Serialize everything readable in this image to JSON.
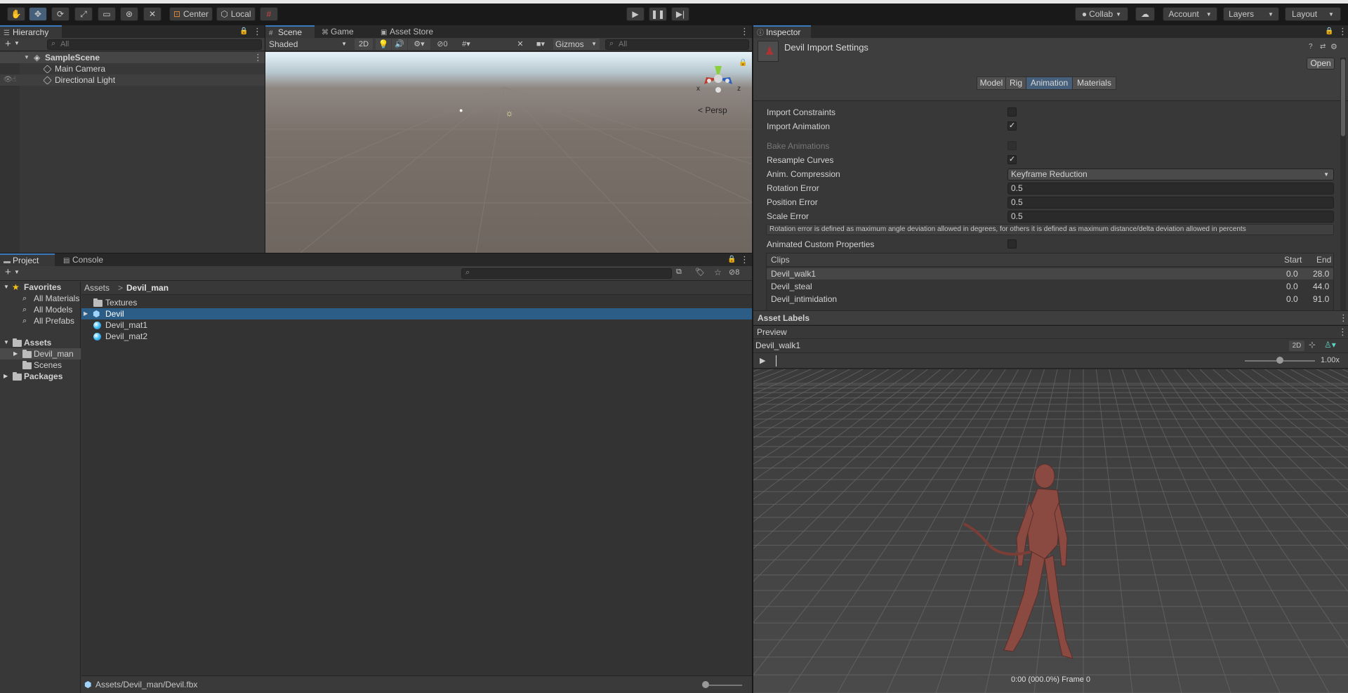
{
  "toolbar": {
    "tools": [
      "hand-tool",
      "move-tool",
      "rotate-tool",
      "scale-tool",
      "rect-tool",
      "transform-tool",
      "custom-tool"
    ],
    "pivot": "Center",
    "space": "Local",
    "collab": "Collab",
    "account": "Account",
    "layers": "Layers",
    "layout": "Layout"
  },
  "hierarchy": {
    "tab": "Hierarchy",
    "search_placeholder": "All",
    "scene": "SampleScene",
    "items": [
      "Main Camera",
      "Directional Light"
    ]
  },
  "scene_view": {
    "tabs": [
      "Scene",
      "Game",
      "Asset Store"
    ],
    "shading": "Shaded",
    "mode_2d": "2D",
    "hidden_count": "0",
    "gizmos": "Gizmos",
    "search_placeholder": "All",
    "persp": "< Persp",
    "axis_x": "x",
    "axis_z": "z"
  },
  "project": {
    "tabs": [
      "Project",
      "Console"
    ],
    "favorites_label": "Favorites",
    "favorites": [
      "All Materials",
      "All Models",
      "All Prefabs"
    ],
    "assets_label": "Assets",
    "asset_folders": [
      "Devil_man",
      "Scenes"
    ],
    "packages_label": "Packages",
    "breadcrumb_root": "Assets",
    "breadcrumb_sep": ">",
    "breadcrumb_current": "Devil_man",
    "files": [
      "Textures",
      "Devil",
      "Devil_mat1",
      "Devil_mat2"
    ],
    "hidden_count": "8",
    "status_path": "Assets/Devil_man/Devil.fbx"
  },
  "inspector": {
    "tab": "Inspector",
    "title": "Devil Import Settings",
    "open_button": "Open",
    "tabs": [
      "Model",
      "Rig",
      "Animation",
      "Materials"
    ],
    "selected_tab": "Animation",
    "import_constraints_label": "Import Constraints",
    "import_constraints": false,
    "import_animation_label": "Import Animation",
    "import_animation": true,
    "bake_animations_label": "Bake Animations",
    "resample_curves_label": "Resample Curves",
    "resample_curves": true,
    "anim_compression_label": "Anim. Compression",
    "anim_compression": "Keyframe Reduction",
    "rotation_error_label": "Rotation Error",
    "rotation_error": "0.5",
    "position_error_label": "Position Error",
    "position_error": "0.5",
    "scale_error_label": "Scale Error",
    "scale_error": "0.5",
    "help_text": "Rotation error is defined as maximum angle deviation allowed in degrees, for others it is defined as maximum distance/delta deviation allowed in percents",
    "animated_custom_props_label": "Animated Custom Properties",
    "clips_header": "Clips",
    "start_header": "Start",
    "end_header": "End",
    "clips": [
      {
        "name": "Devil_walk1",
        "start": "0.0",
        "end": "28.0"
      },
      {
        "name": "Devil_steal",
        "start": "0.0",
        "end": "44.0"
      },
      {
        "name": "Devil_intimidation",
        "start": "0.0",
        "end": "91.0"
      }
    ],
    "asset_labels": "Asset Labels"
  },
  "preview": {
    "label": "Preview",
    "clip": "Devil_walk1",
    "mode_2d": "2D",
    "speed": "1.00x",
    "time": "0:00 (000.0%) Frame 0"
  },
  "colors": {
    "accent": "#3a79bb",
    "selection": "#2c5d87",
    "panel": "#383838",
    "toolbar": "#191919"
  }
}
